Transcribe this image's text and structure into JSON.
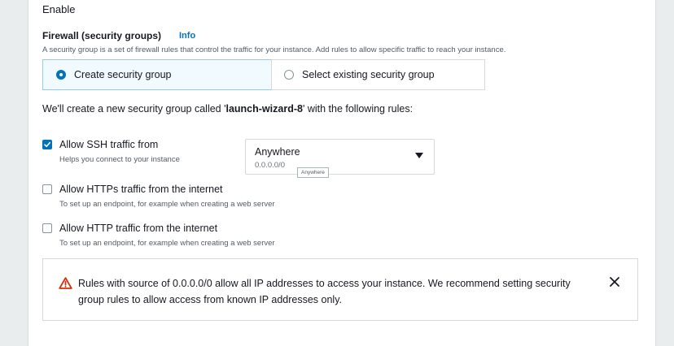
{
  "enable_label": "Enable",
  "firewall": {
    "title": "Firewall (security groups)",
    "info_link": "Info",
    "description": "A security group is a set of firewall rules that control the traffic for your instance. Add rules to allow specific traffic to reach your instance.",
    "options": [
      {
        "label": "Create security group",
        "selected": true
      },
      {
        "label": "Select existing security group",
        "selected": false
      }
    ],
    "note_prefix": "We'll create a new security group called '",
    "group_name": "launch-wizard-8",
    "note_suffix": "' with the following rules:"
  },
  "rules": [
    {
      "label": "Allow SSH traffic from",
      "description": "Helps you connect to your instance",
      "checked": true
    },
    {
      "label": "Allow HTTPs traffic from the internet",
      "description": "To set up an endpoint, for example when creating a web server",
      "checked": false
    },
    {
      "label": "Allow HTTP traffic from the internet",
      "description": "To set up an endpoint, for example when creating a web server",
      "checked": false
    }
  ],
  "ssh_source_select": {
    "value": "Anywhere",
    "sub": "0.0.0.0/0",
    "tooltip": "Anywhere"
  },
  "warning": {
    "text": "Rules with source of 0.0.0.0/0 allow all IP addresses to access your instance. We recommend setting security group rules to allow access from known IP addresses only.",
    "color": "#d13212"
  },
  "colors": {
    "accent": "#0073bb",
    "selected_bg": "#f1faff"
  }
}
